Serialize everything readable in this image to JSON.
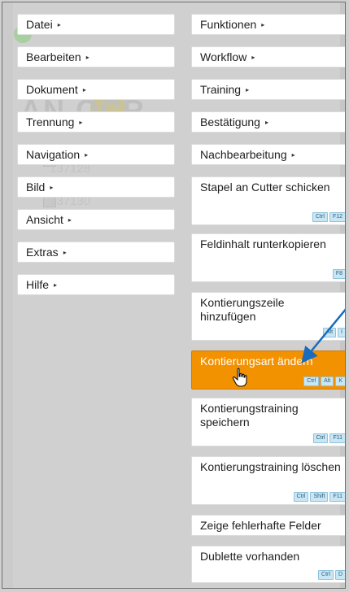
{
  "left_menu": [
    {
      "label": "Datei",
      "arrow": "▸"
    },
    {
      "label": "Bearbeiten",
      "arrow": "▸"
    },
    {
      "label": "Dokument",
      "arrow": "▸"
    },
    {
      "label": "Trennung",
      "arrow": "▸"
    },
    {
      "label": "Navigation",
      "arrow": "▸"
    },
    {
      "label": "Bild",
      "arrow": "▸"
    },
    {
      "label": "Ansicht",
      "arrow": "▸"
    },
    {
      "label": "Extras",
      "arrow": "▸"
    },
    {
      "label": "Hilfe",
      "arrow": "▸"
    }
  ],
  "right_menu": [
    {
      "label": "Funktionen",
      "arrow": "▸"
    },
    {
      "label": "Workflow",
      "arrow": "▸"
    },
    {
      "label": "Training",
      "arrow": "▸"
    },
    {
      "label": "Bestätigung",
      "arrow": "▸"
    },
    {
      "label": "Nachbearbeitung",
      "arrow": "▸"
    },
    {
      "label": "Stapel an Cutter schicken",
      "shortcut": [
        "Ctrl",
        "F12"
      ]
    },
    {
      "label": "Feldinhalt runterkopieren",
      "shortcut": [
        "F8"
      ]
    },
    {
      "label": "Kontierungszeile hinzufügen",
      "shortcut": [
        "Alt",
        "I"
      ]
    },
    {
      "label": "Kontierungsart ändern",
      "shortcut": [
        "Ctrl",
        "Alt",
        "K"
      ],
      "highlighted": true
    },
    {
      "label": "Kontierungstraining speichern",
      "shortcut": [
        "Ctrl",
        "F11"
      ]
    },
    {
      "label": "Kontierungstraining löschen",
      "shortcut": [
        "Ctrl",
        "Shift",
        "F11"
      ]
    },
    {
      "label": "Zeige fehlerhafte Felder"
    },
    {
      "label": "Dublette vorhanden",
      "shortcut": [
        "Ctrl",
        "D"
      ]
    }
  ],
  "background": {
    "logo_text": "AN      OCR",
    "row_1": "137128",
    "row_2": "137130"
  },
  "colors": {
    "highlight": "#f39200",
    "shortcut_bg": "#c9e6f4",
    "annotation_arrow": "#1a6bbf"
  },
  "icons": {
    "hand_cursor": "hand-pointer-icon",
    "submenu_arrow": "triangle-right-icon",
    "annotation": "blue-arrow-icon"
  }
}
